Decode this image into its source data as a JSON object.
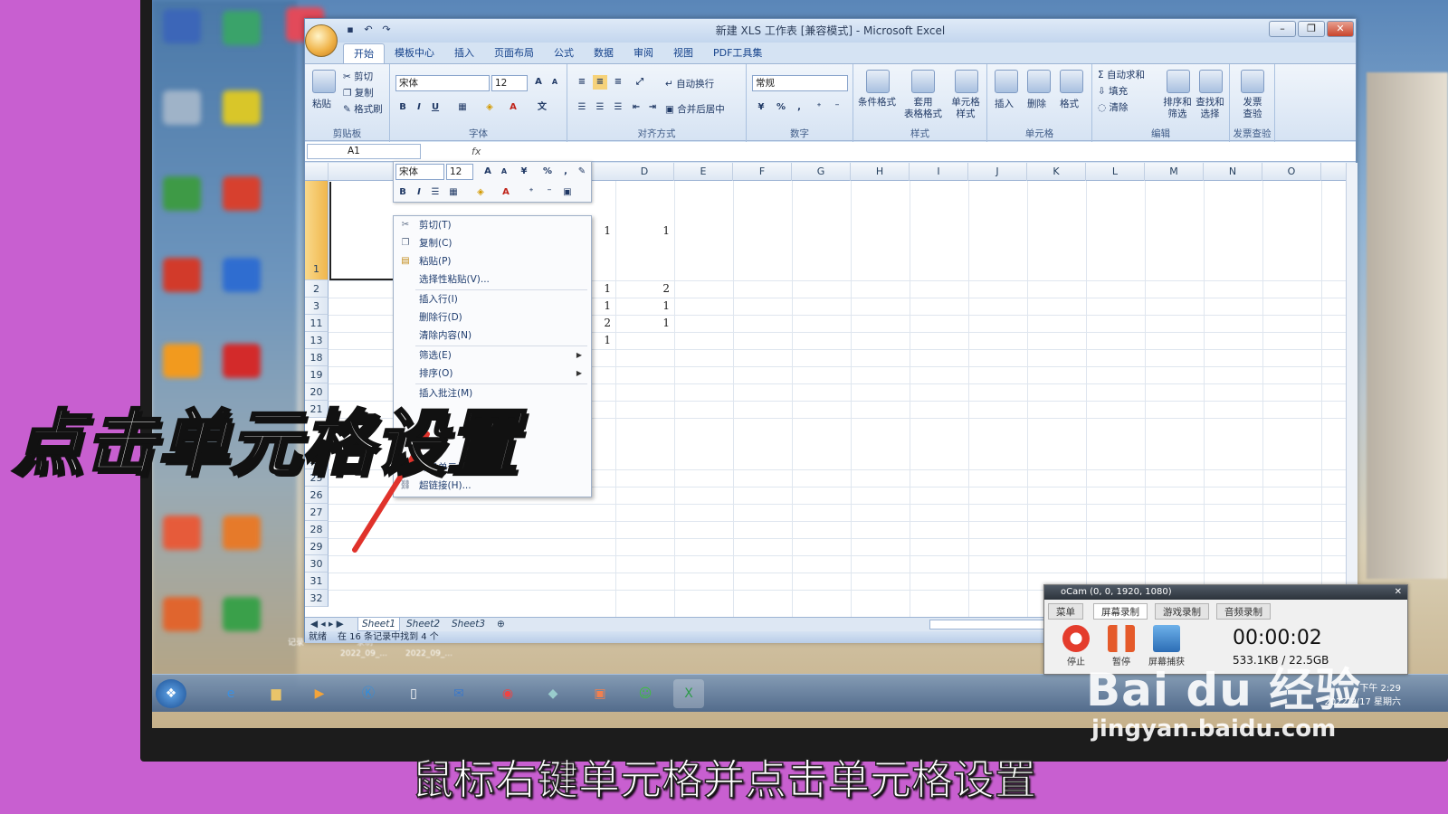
{
  "caption": "点击单元格设置",
  "subtitle": "鼠标右键单元格并点击单元格设置",
  "watermark": {
    "logo": "Bai du 经验",
    "url": "jingyan.baidu.com"
  },
  "excel": {
    "title": "新建 XLS 工作表 [兼容模式] - Microsoft Excel",
    "tabs": [
      "开始",
      "模板中心",
      "插入",
      "页面布局",
      "公式",
      "数据",
      "审阅",
      "视图",
      "PDF工具集"
    ],
    "ribbon": {
      "clipboard": {
        "label": "剪贴板",
        "paste": "粘贴",
        "cut": "剪切",
        "copy": "复制",
        "format_painter": "格式刷"
      },
      "font": {
        "label": "字体",
        "font_name": "宋体",
        "font_size": "12"
      },
      "alignment": {
        "label": "对齐方式",
        "wrap": "自动换行",
        "merge": "合并后居中"
      },
      "number": {
        "label": "数字",
        "format": "常规"
      },
      "styles": {
        "label": "样式",
        "conditional": "条件格式",
        "table": "套用\n表格格式",
        "cell_style": "单元格\n样式"
      },
      "cells": {
        "label": "单元格",
        "insert": "插入",
        "delete": "删除",
        "format": "格式"
      },
      "editing": {
        "label": "编辑",
        "autosum": "自动求和",
        "fill": "填充",
        "clear": "清除",
        "sort": "排序和\n筛选",
        "find": "查找和\n选择"
      },
      "invoice": {
        "label": "发票查验",
        "check": "发票\n查验"
      }
    },
    "name_box": "A1",
    "fx": "fx",
    "columns": [
      "D",
      "E",
      "F",
      "G",
      "H",
      "I",
      "J",
      "K",
      "L",
      "M",
      "N",
      "O"
    ],
    "rows": [
      "1",
      "2",
      "3",
      "11",
      "13",
      "18",
      "19",
      "20",
      "21",
      "24",
      "25",
      "26",
      "27",
      "28",
      "29",
      "30",
      "31",
      "32"
    ],
    "cells": [
      {
        "c": "1",
        "d": "1"
      },
      {
        "c": "1",
        "d": "2"
      },
      {
        "c": "1",
        "d": "1"
      },
      {
        "c": "2",
        "d": "1"
      },
      {
        "c": "1",
        "d": ""
      }
    ],
    "mini_toolbar": {
      "font": "宋体",
      "size": "12"
    },
    "context_menu": [
      {
        "label": "剪切(T)",
        "icon": "scissors-icon",
        "sub": false
      },
      {
        "label": "复制(C)",
        "icon": "copy-icon",
        "sub": false
      },
      {
        "label": "粘贴(P)",
        "icon": "paste-icon",
        "sub": false
      },
      {
        "label": "选择性粘贴(V)...",
        "icon": "",
        "sub": false
      },
      {
        "label": "插入行(I)",
        "icon": "",
        "sub": false
      },
      {
        "label": "删除行(D)",
        "icon": "",
        "sub": false
      },
      {
        "label": "清除内容(N)",
        "icon": "",
        "sub": false
      },
      {
        "label": "筛选(E)",
        "icon": "",
        "sub": true
      },
      {
        "label": "排序(O)",
        "icon": "",
        "sub": true
      },
      {
        "label": "插入批注(M)",
        "icon": "",
        "sub": false
      },
      {
        "label": "命名单元格区域(R)...",
        "icon": "",
        "sub": false
      },
      {
        "label": "超链接(H)...",
        "icon": "",
        "sub": false
      }
    ],
    "sheets": [
      "Sheet1",
      "Sheet2",
      "Sheet3"
    ],
    "status": {
      "ready": "就绪",
      "message": "在 16 条记录中找到 4 个"
    }
  },
  "ocam": {
    "title": "oCam (0, 0, 1920, 1080)",
    "tabs": [
      "菜单",
      "屏幕录制",
      "游戏录制",
      "音频录制"
    ],
    "buttons": {
      "stop": "停止",
      "pause": "暂停",
      "capture": "屏幕捕获"
    },
    "timer": "00:00:02",
    "size": "533.1KB / 22.5GB"
  },
  "taskbar": {
    "time": "下午 2:29",
    "date": "2022/9/17 星期六"
  },
  "desktop_labels": [
    "记录",
    "录制",
    "2022_09_...",
    "2022_09_..."
  ],
  "colors": {
    "background": "#c85fd0",
    "arrow": "#e0322b",
    "excel_accent": "#15428b"
  }
}
